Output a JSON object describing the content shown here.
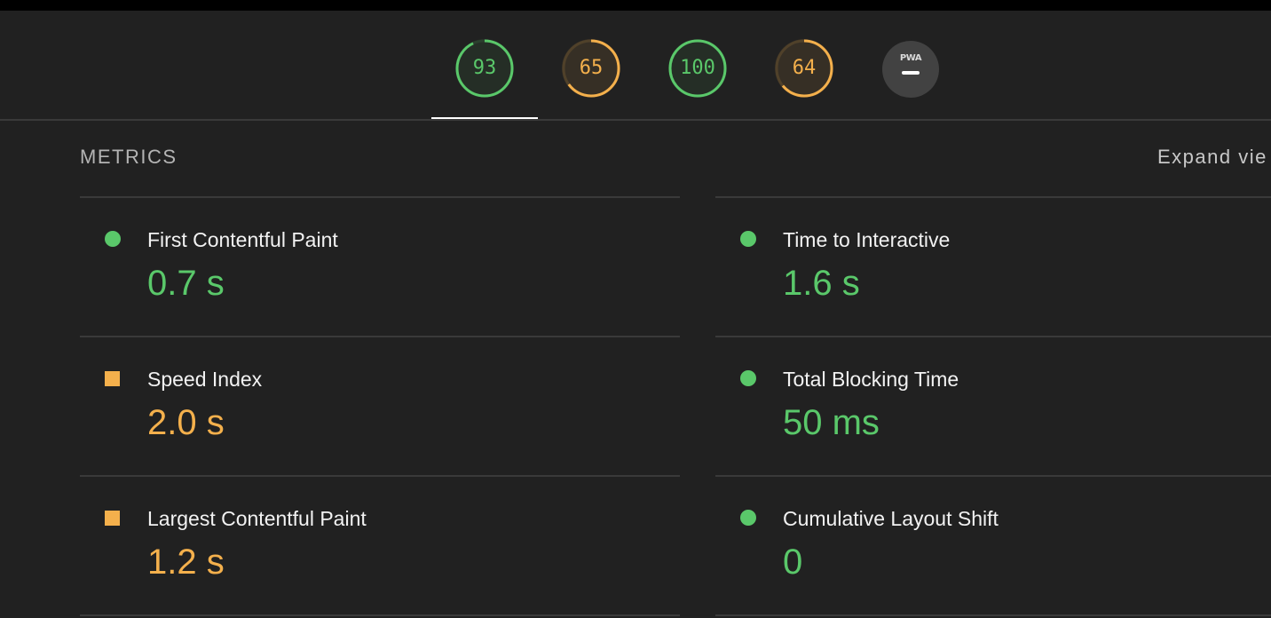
{
  "colors": {
    "pass": "#5ac86a",
    "average": "#f4b04c",
    "fail": "#ff4e42"
  },
  "gauges": [
    {
      "score": 93,
      "value": 0.93,
      "rating": "pass"
    },
    {
      "score": 65,
      "value": 0.65,
      "rating": "average"
    },
    {
      "score": 100,
      "value": 1.0,
      "rating": "pass"
    },
    {
      "score": 64,
      "value": 0.64,
      "rating": "average"
    }
  ],
  "pwa": {
    "label": "PWA"
  },
  "metrics_section": {
    "title": "METRICS",
    "expand_label": "Expand vie"
  },
  "metrics": [
    {
      "title": "First Contentful Paint",
      "value": "0.7 s",
      "rating": "pass",
      "icon": "circle-icon"
    },
    {
      "title": "Time to Interactive",
      "value": "1.6 s",
      "rating": "pass",
      "icon": "circle-icon"
    },
    {
      "title": "Speed Index",
      "value": "2.0 s",
      "rating": "average",
      "icon": "square-icon"
    },
    {
      "title": "Total Blocking Time",
      "value": "50 ms",
      "rating": "pass",
      "icon": "circle-icon"
    },
    {
      "title": "Largest Contentful Paint",
      "value": "1.2 s",
      "rating": "average",
      "icon": "square-icon"
    },
    {
      "title": "Cumulative Layout Shift",
      "value": "0",
      "rating": "pass",
      "icon": "circle-icon"
    }
  ]
}
